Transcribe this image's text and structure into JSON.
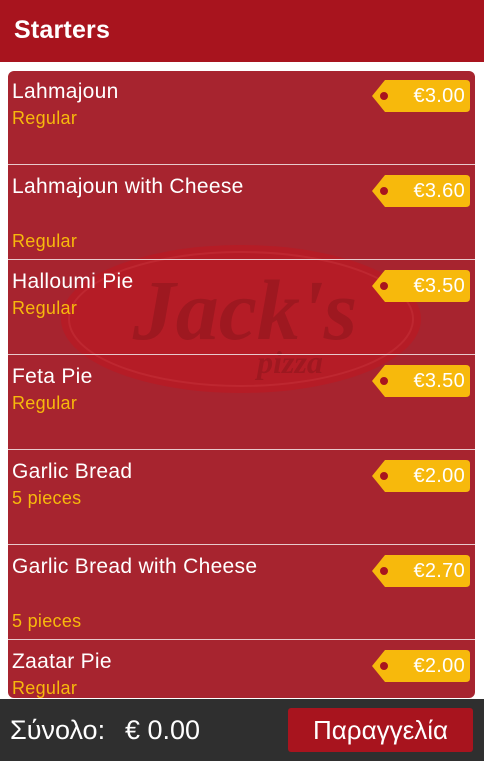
{
  "header": {
    "title": "Starters"
  },
  "watermark": {
    "brand": "Jack's",
    "sub": "pizza"
  },
  "items": [
    {
      "name": "Lahmajoun",
      "size": "Regular",
      "price": "€3.00"
    },
    {
      "name": "Lahmajoun with Cheese",
      "size": "Regular",
      "price": "€3.60"
    },
    {
      "name": "Halloumi Pie",
      "size": "Regular",
      "price": "€3.50"
    },
    {
      "name": "Feta Pie",
      "size": "Regular",
      "price": "€3.50"
    },
    {
      "name": "Garlic Bread",
      "size": "5 pieces",
      "price": "€2.00"
    },
    {
      "name": "Garlic Bread with Cheese",
      "size": "5 pieces",
      "price": "€2.70"
    },
    {
      "name": "Zaatar Pie",
      "size": "Regular",
      "price": "€2.00"
    }
  ],
  "footer": {
    "total_label": "Σύνολο:",
    "total_value": "€ 0.00",
    "order_label": "Παραγγελία"
  },
  "colors": {
    "header": "#a8141e",
    "list_bg": "#a7242f",
    "accent": "#f7b90c",
    "footer": "#2f2f2f"
  },
  "icons": {
    "price_tag": "price-tag-icon",
    "logo": "jacks-pizza-logo"
  }
}
